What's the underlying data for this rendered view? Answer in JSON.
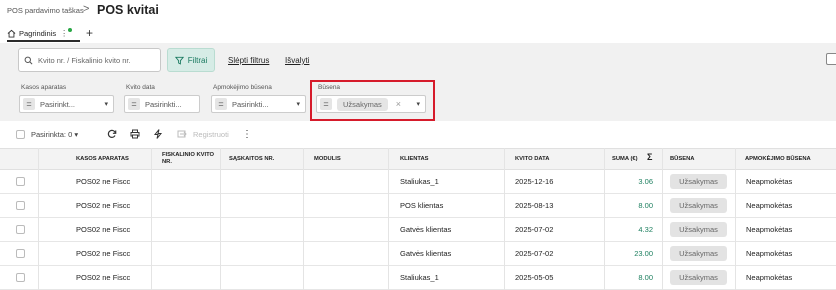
{
  "breadcrumb": {
    "parent": "POS pardavimo taškas",
    "separator": ">",
    "title": "POS kvitai"
  },
  "tabs": [
    {
      "label": "Pagrindinis"
    }
  ],
  "tab_add_label": "+",
  "search": {
    "placeholder": "Kvito nr. / Fiskalinio kvito nr."
  },
  "toolbar_top": {
    "filter_label": "Filtrai",
    "hide_filter_label": "Slėpti filtrus",
    "clear_label": "Išvalyti"
  },
  "filters": [
    {
      "label": "Kasos aparatas",
      "value": "Pasirinkt..."
    },
    {
      "label": "Kvito data",
      "value": "Pasirinkti..."
    },
    {
      "label": "Apmokėjimo būsena",
      "value": "Pasirinkti..."
    },
    {
      "label": "Būsena",
      "value": "Užsakymas"
    }
  ],
  "list_toolbar": {
    "select_label": "Pasirinkta: 0",
    "register_label": "Registruoti"
  },
  "icons": {
    "refresh": "refresh-icon",
    "print": "print-icon",
    "bolt": "bolt-icon",
    "register": "register-icon",
    "more": "more-vertical-icon",
    "sum": "sigma-icon"
  },
  "colors": {
    "accent": "#1d7f5f",
    "highlight": "#d61b2b"
  },
  "table": {
    "columns": [
      "Kasos aparatas",
      "Fiskalinio kvito nr.",
      "Sąskaitos nr.",
      "Modulis",
      "Klientas",
      "Kvito data",
      "Suma (€)",
      "Būsena",
      "Apmokėjimo būsena"
    ],
    "rows": [
      {
        "kasa": "POS02 ne Fiscc",
        "fisk": "",
        "sask": "",
        "modulis": "",
        "klientas": "Staliukas_1",
        "data": "2025-12-16",
        "suma": "3.06",
        "busena": "Užsakymas",
        "apmok": "Neapmokėtas"
      },
      {
        "kasa": "POS02 ne Fiscc",
        "fisk": "",
        "sask": "",
        "modulis": "",
        "klientas": "POS klientas",
        "data": "2025-08-13",
        "suma": "8.00",
        "busena": "Užsakymas",
        "apmok": "Neapmokėtas"
      },
      {
        "kasa": "POS02 ne Fiscc",
        "fisk": "",
        "sask": "",
        "modulis": "",
        "klientas": "Gatvės klientas",
        "data": "2025-07-02",
        "suma": "4.32",
        "busena": "Užsakymas",
        "apmok": "Neapmokėtas"
      },
      {
        "kasa": "POS02 ne Fiscc",
        "fisk": "",
        "sask": "",
        "modulis": "",
        "klientas": "Gatvės klientas",
        "data": "2025-07-02",
        "suma": "23.00",
        "busena": "Užsakymas",
        "apmok": "Neapmokėtas"
      },
      {
        "kasa": "POS02 ne Fiscc",
        "fisk": "",
        "sask": "",
        "modulis": "",
        "klientas": "Staliukas_1",
        "data": "2025-05-05",
        "suma": "8.00",
        "busena": "Užsakymas",
        "apmok": "Neapmokėtas"
      }
    ]
  }
}
